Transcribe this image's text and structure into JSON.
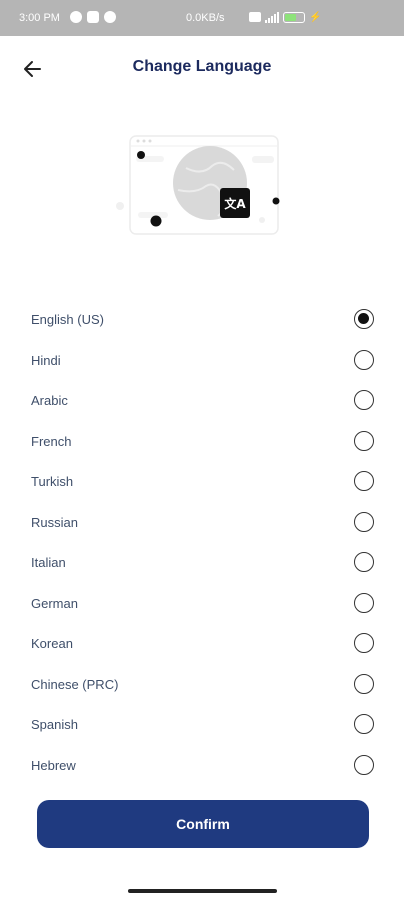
{
  "status_bar": {
    "time": "3:00 PM",
    "speed": "0.0KB/s",
    "battery_level": 0.6,
    "icons": [
      "notification-icon",
      "notification-icon",
      "notification-icon",
      "sim-icon",
      "signal-icon",
      "battery-icon",
      "charging-icon"
    ]
  },
  "header": {
    "title": "Change Language",
    "back_icon": "arrow-left-icon"
  },
  "illustration": {
    "icon": "translate-icon",
    "translate_glyph": "文A"
  },
  "languages": [
    {
      "label": "English (US)",
      "selected": true
    },
    {
      "label": "Hindi",
      "selected": false
    },
    {
      "label": "Arabic",
      "selected": false
    },
    {
      "label": "French",
      "selected": false
    },
    {
      "label": "Turkish",
      "selected": false
    },
    {
      "label": "Russian",
      "selected": false
    },
    {
      "label": "Italian",
      "selected": false
    },
    {
      "label": "German",
      "selected": false
    },
    {
      "label": "Korean",
      "selected": false
    },
    {
      "label": "Chinese (PRC)",
      "selected": false
    },
    {
      "label": "Spanish",
      "selected": false
    },
    {
      "label": "Hebrew",
      "selected": false
    }
  ],
  "confirm_label": "Confirm",
  "colors": {
    "primary": "#1f3a80",
    "title": "#1c2a5e",
    "label": "#3f4f6a",
    "status_bar": "#b5b5b5"
  }
}
